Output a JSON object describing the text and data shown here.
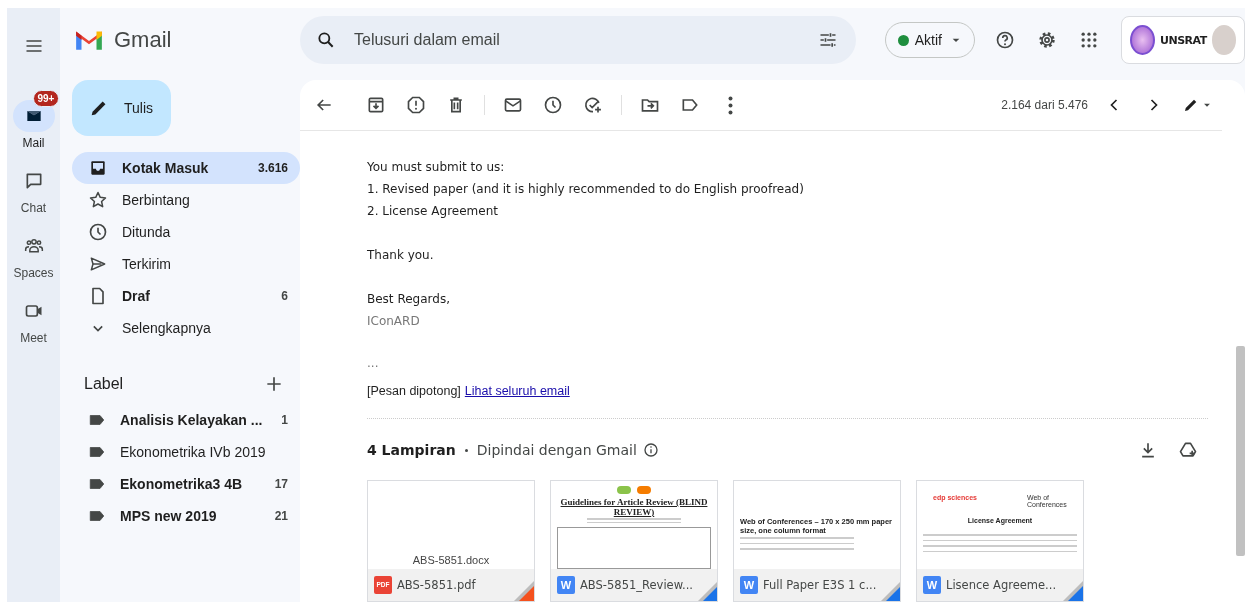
{
  "rail": [
    {
      "label": "Mail",
      "selected": true,
      "badge": "99+"
    },
    {
      "label": "Chat",
      "selected": false
    },
    {
      "label": "Spaces",
      "selected": false
    },
    {
      "label": "Meet",
      "selected": false
    }
  ],
  "app": {
    "name": "Gmail"
  },
  "compose": {
    "label": "Tulis"
  },
  "folders": [
    {
      "label": "Kotak Masuk",
      "count": "3.616",
      "selected": true,
      "bold": true
    },
    {
      "label": "Berbintang",
      "selected": false,
      "bold": false
    },
    {
      "label": "Ditunda",
      "selected": false,
      "bold": false
    },
    {
      "label": "Terkirim",
      "selected": false,
      "bold": false
    },
    {
      "label": "Draf",
      "count": "6",
      "selected": false,
      "bold": true
    },
    {
      "label": "Selengkapnya",
      "selected": false,
      "bold": false
    }
  ],
  "labels": {
    "title": "Label",
    "items": [
      {
        "label": "Analisis Kelayakan ...",
        "count": "1",
        "bold": true
      },
      {
        "label": "Ekonometrika IVb 2019",
        "bold": false
      },
      {
        "label": "Ekonometrika3 4B",
        "count": "17",
        "bold": true
      },
      {
        "label": "MPS new 2019",
        "count": "21",
        "bold": true
      }
    ]
  },
  "search": {
    "placeholder": "Telusuri dalam email"
  },
  "status": {
    "label": "Aktif"
  },
  "account": {
    "org": "UNSRAT"
  },
  "toolbar": {
    "position": "2.164 dari 5.476"
  },
  "message": {
    "paragraphs": [
      [
        "You must submit to us:",
        "1. Revised paper (and it is highly recommended to do English proofread)",
        "2. License Agreement"
      ],
      [
        "Thank you."
      ],
      [
        "Best Regards,"
      ]
    ],
    "signature": "IConARD",
    "ellipsis": "...",
    "clipped": "[Pesan dipotong]",
    "view_link": "Lihat seluruh email"
  },
  "attachments": {
    "count": "4 Lampiran",
    "scan": "Dipindai dengan Gmail",
    "items": [
      {
        "name": "ABS-5851.pdf",
        "kind": "pdf",
        "badge": "PDF",
        "preview_text": "ABS-5851.docx"
      },
      {
        "name": "ABS-5851_Review...",
        "kind": "word",
        "badge": "W",
        "preview_text": "Guidelines for Article Review (BLIND REVIEW)"
      },
      {
        "name": "Full Paper E3S 1 c...",
        "kind": "word",
        "badge": "W",
        "preview_text": "Web of Conferences – 170 x 250 mm paper size, one column format"
      },
      {
        "name": "Lisence Agreeme...",
        "kind": "word",
        "badge": "W",
        "preview_logos": [
          "edp sciences",
          "Web of Conferences"
        ],
        "preview_text": "License Agreement"
      }
    ]
  }
}
